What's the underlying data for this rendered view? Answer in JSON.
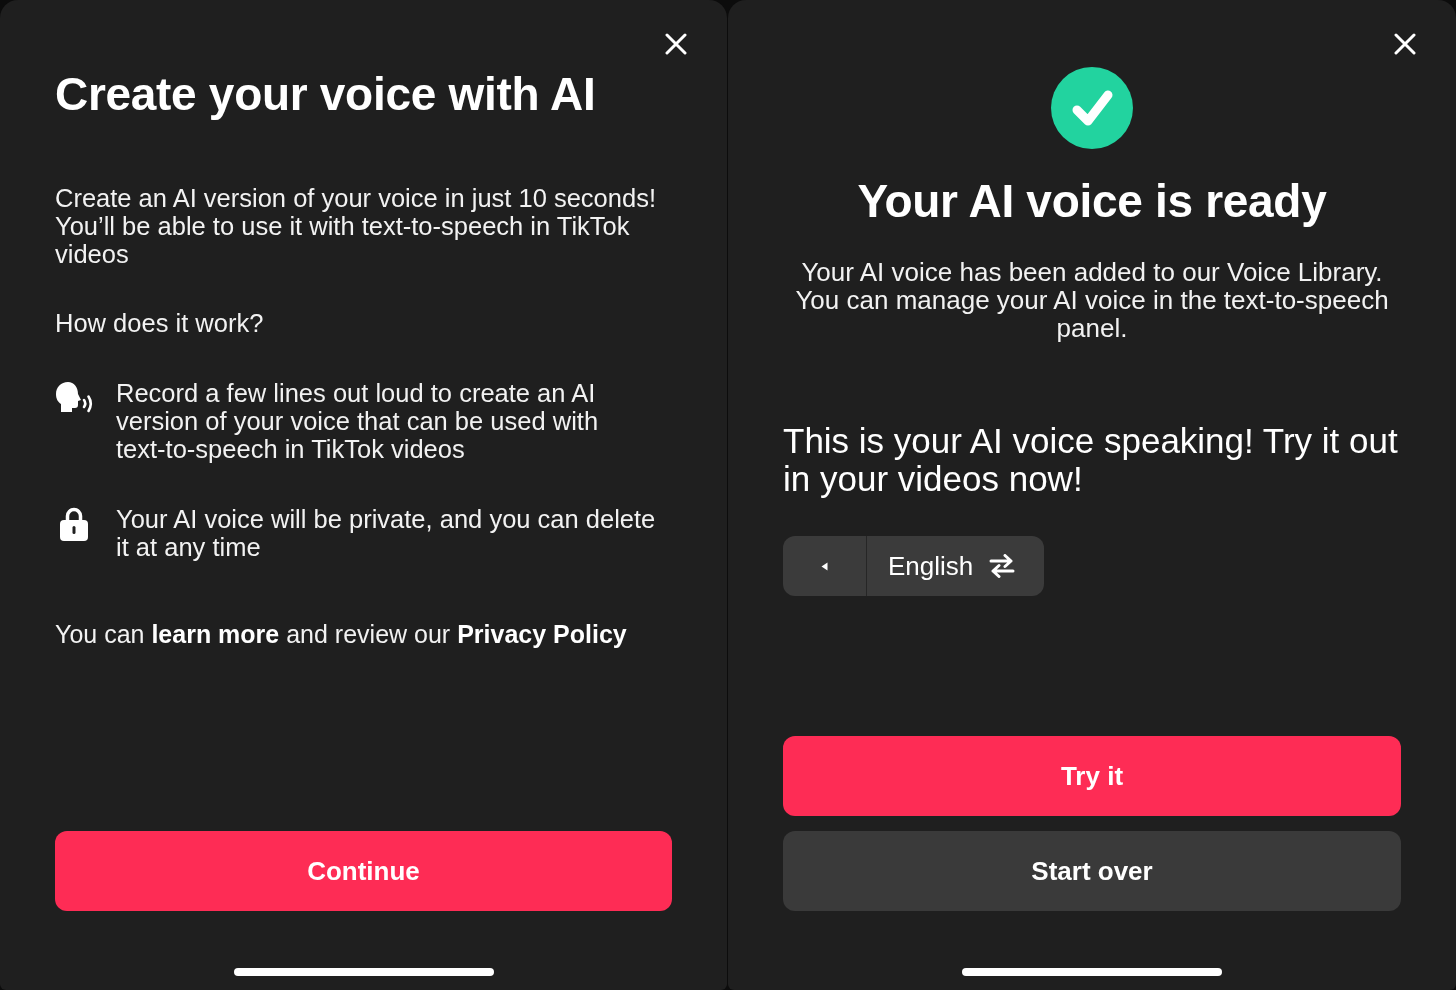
{
  "left_screen": {
    "title": "Create your voice with AI",
    "description": "Create an AI version of your voice in just 10 seconds! You’ll be able to use it with text-to-speech in TikTok videos",
    "question": "How does it work?",
    "features": [
      {
        "kind": "voice",
        "text": "Record a few lines out loud to create an AI version of your voice that can be used with text-to-speech in TikTok videos"
      },
      {
        "kind": "privacy",
        "text": "Your AI voice will be private, and you can delete it at any time"
      }
    ],
    "footer": [
      {
        "kind": "text",
        "text": "You can"
      },
      {
        "kind": "link",
        "text": "learn more"
      },
      {
        "kind": "text",
        "text": "and review our"
      },
      {
        "kind": "link",
        "text": "Privacy Policy"
      }
    ],
    "button": {
      "kind": "primary",
      "label": "Continue"
    }
  },
  "right_screen": {
    "title": "Your AI voice is ready",
    "description": "Your AI voice has been added to our Voice Library. You can manage your AI voice in the text-to-speech panel.",
    "sample_text": "This is your AI voice speaking! Try it out in your videos now!",
    "language": "English",
    "buttons": [
      {
        "kind": "primary",
        "label": "Try it"
      },
      {
        "kind": "secondary",
        "label": "Start over"
      }
    ]
  }
}
